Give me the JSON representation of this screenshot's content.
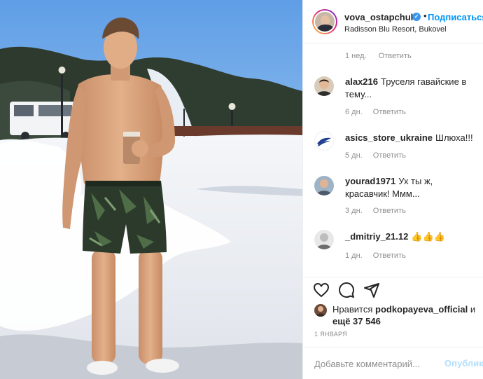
{
  "colors": {
    "accent": "#0095f6",
    "text": "#262626",
    "muted": "#8e8e8e",
    "verified": "#3897f0"
  },
  "post": {
    "username": "vova_ostapchuk",
    "verified_icon": "verified-badge-icon",
    "follow_label": "Подписаться",
    "separator": "•",
    "location": "Radisson Blu Resort, Bukovel",
    "photo_alt": "Мужчина в шортах на снегу с чашкой"
  },
  "caption_meta": {
    "time": "1 нед.",
    "reply": "Ответить"
  },
  "comments": [
    {
      "user": "alax216",
      "text": "Труселя гавайские в тему...",
      "time": "6 дн.",
      "reply": "Ответить"
    },
    {
      "user": "asics_store_ukraine",
      "text": "Шлюха!!!",
      "time": "5 дн.",
      "reply": "Ответить"
    },
    {
      "user": "yourad1971",
      "text": "Ух ты ж, красавчик! Ммм...",
      "time": "3 дн.",
      "reply": "Ответить"
    },
    {
      "user": "_dmitriy_21.12",
      "text": "👍👍👍",
      "time": "1 дн.",
      "reply": "Ответить"
    }
  ],
  "actions": {
    "icons": [
      "heart-icon",
      "comment-icon",
      "share-icon"
    ]
  },
  "likes": {
    "prefix": "Нравится",
    "user": "podkopayeva_official",
    "suffix_and": "и",
    "more": "ещё 37 546"
  },
  "date": "1 января",
  "comment_box": {
    "placeholder": "Добавьте комментарий...",
    "publish": "Опубликовать"
  }
}
